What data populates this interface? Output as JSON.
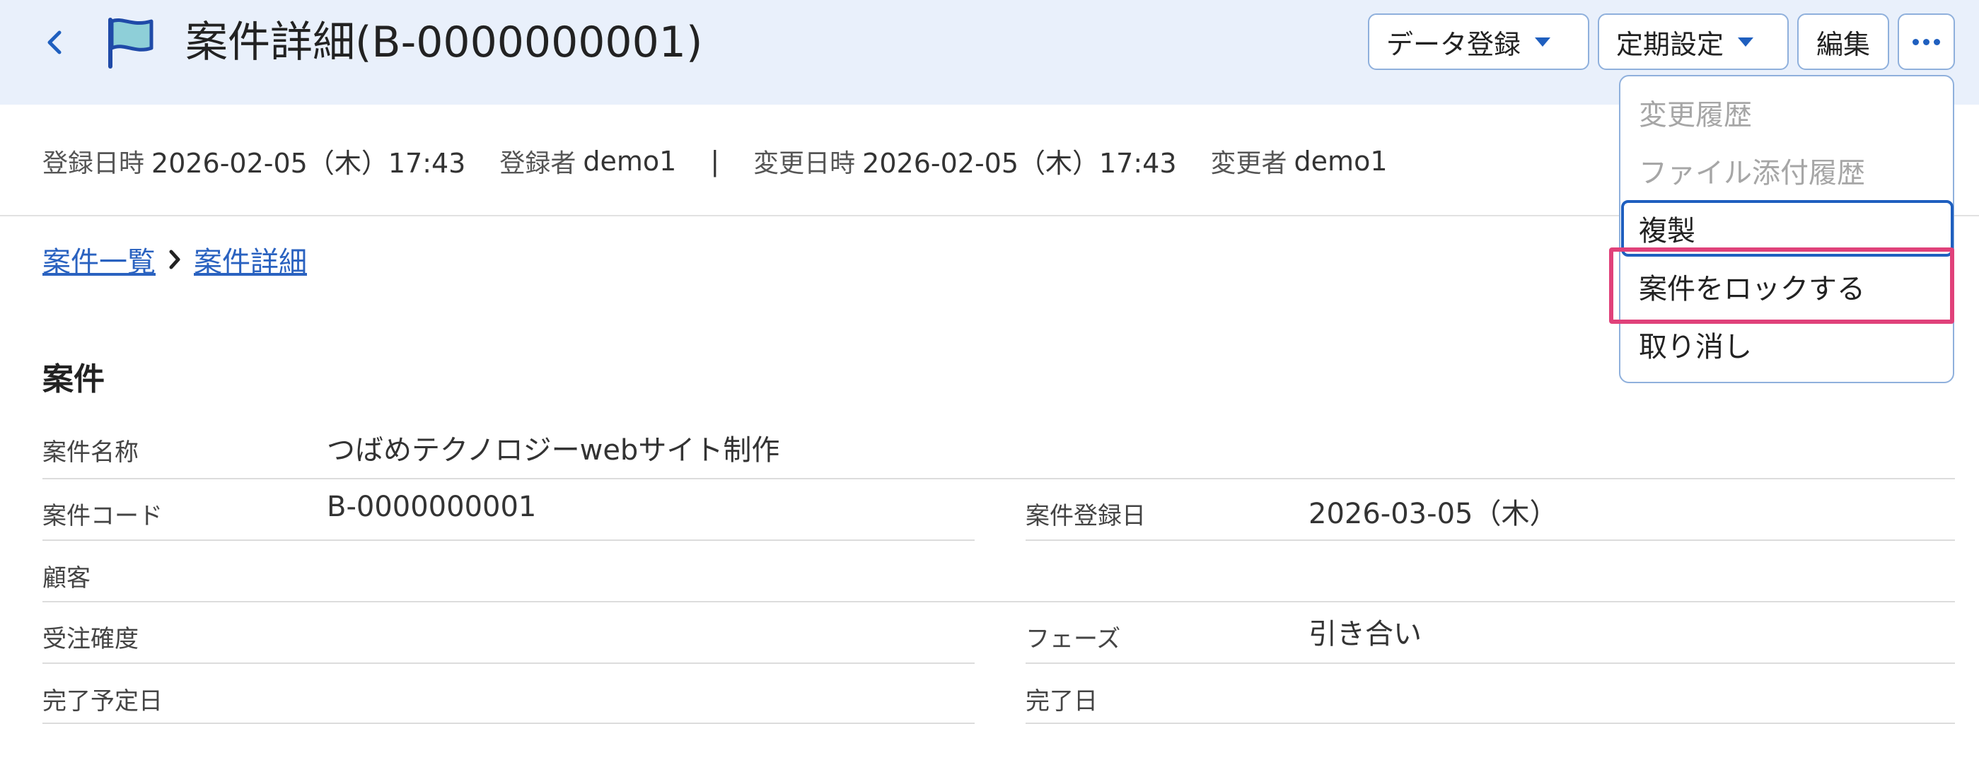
{
  "header": {
    "title": "案件詳細(B-0000000001)",
    "buttons": {
      "data_register": "データ登録",
      "schedule": "定期設定",
      "edit": "編集"
    }
  },
  "meta": {
    "registered_at_label": "登録日時",
    "registered_at": "2026-02-05（木）17:43",
    "registered_by_label": "登録者",
    "registered_by": "demo1",
    "separator": "|",
    "updated_at_label": "変更日時",
    "updated_at": "2026-02-05（木）17:43",
    "updated_by_label": "変更者",
    "updated_by": "demo1"
  },
  "breadcrumb": {
    "list": "案件一覧",
    "detail": "案件詳細"
  },
  "section": {
    "title": "案件",
    "fields": {
      "name_label": "案件名称",
      "name_value": "つばめテクノロジーwebサイト制作",
      "code_label": "案件コード",
      "code_value": "B-0000000001",
      "reg_date_label": "案件登録日",
      "reg_date_value": "2026-03-05（木）",
      "customer_label": "顧客",
      "customer_value": "",
      "probability_label": "受注確度",
      "probability_value": "",
      "phase_label": "フェーズ",
      "phase_value": "引き合い",
      "due_label": "完了予定日",
      "due_value": "",
      "done_label": "完了日",
      "done_value": ""
    }
  },
  "menu": {
    "history": "変更履歴",
    "attachment_history": "ファイル添付履歴",
    "duplicate": "複製",
    "lock": "案件をロックする",
    "cancel": "取り消し"
  },
  "colors": {
    "header_bg": "#e9f0fb",
    "accent": "#1f5fbf",
    "highlight": "#e0417a",
    "flag": "#8ecfd8"
  },
  "icons": [
    "back-chevron-icon",
    "flag-icon",
    "caret-down-icon",
    "more-dots-icon",
    "breadcrumb-chevron-icon"
  ]
}
